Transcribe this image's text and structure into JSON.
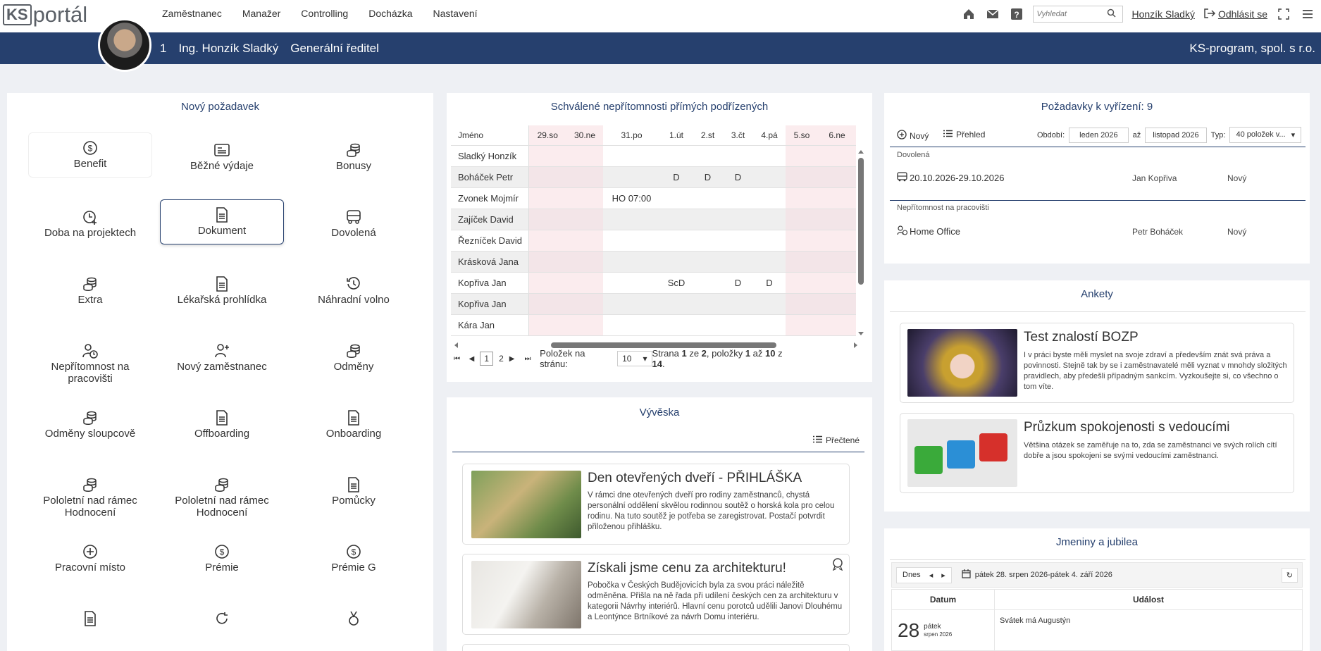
{
  "app": {
    "logo_ks": "KS",
    "logo_text": "portál"
  },
  "nav": {
    "items": [
      "Zaměstnanec",
      "Manažer",
      "Controlling",
      "Docházka",
      "Nastavení"
    ]
  },
  "topright": {
    "search_placeholder": "Vyhledat",
    "user": "Honzík Sladký",
    "logout": "Odhlásit se"
  },
  "userbar": {
    "id": "1",
    "name": "Ing. Honzík Sladký",
    "role": "Generální ředitel",
    "company": "KS-program, spol. s r.o."
  },
  "new_request": {
    "title": "Nový požadavek",
    "items": [
      {
        "label": "Benefit",
        "icon": "dollar-circle-icon"
      },
      {
        "label": "Běžné výdaje",
        "icon": "receipt-icon"
      },
      {
        "label": "Bonusy",
        "icon": "coins-icon"
      },
      {
        "label": "Doba na projektech",
        "icon": "clock-plus-icon"
      },
      {
        "label": "Dokument",
        "icon": "document-icon"
      },
      {
        "label": "Dovolená",
        "icon": "bus-icon"
      },
      {
        "label": "Extra",
        "icon": "coins-icon"
      },
      {
        "label": "Lékařská prohlídka",
        "icon": "document-icon"
      },
      {
        "label": "Náhradní volno",
        "icon": "history-icon"
      },
      {
        "label": "Nepřítomnost na pracovišti",
        "icon": "user-clock-icon"
      },
      {
        "label": "Nový zaměstnanec",
        "icon": "user-plus-icon"
      },
      {
        "label": "Odměny",
        "icon": "coins-icon"
      },
      {
        "label": "Odměny sloupcově",
        "icon": "coins-icon"
      },
      {
        "label": "Offboarding",
        "icon": "document-icon"
      },
      {
        "label": "Onboarding",
        "icon": "document-icon"
      },
      {
        "label": "Pololetní nad rámec Hodnocení",
        "icon": "coins-icon"
      },
      {
        "label": "Pololetní nad rámec Hodnocení",
        "icon": "coins-icon"
      },
      {
        "label": "Pomůcky",
        "icon": "document-icon"
      },
      {
        "label": "Pracovní místo",
        "icon": "plus-circle-icon"
      },
      {
        "label": "Prémie",
        "icon": "dollar-circle-icon"
      },
      {
        "label": "Prémie G",
        "icon": "dollar-circle-icon"
      },
      {
        "label": "",
        "icon": "document-icon"
      },
      {
        "label": "",
        "icon": "refresh-icon"
      },
      {
        "label": "",
        "icon": "medal-icon"
      }
    ]
  },
  "absences": {
    "title": "Schválené nepřítomnosti přímých podřízených",
    "name_header": "Jméno",
    "days": [
      "29.so",
      "30.ne",
      "31.po",
      "1.út",
      "2.st",
      "3.čt",
      "4.pá",
      "5.so",
      "6.ne"
    ],
    "rows": [
      {
        "name": "Sladký Honzík",
        "cells": [
          "",
          "",
          "",
          "",
          "",
          "",
          "",
          "",
          ""
        ]
      },
      {
        "name": "Boháček Petr",
        "cells": [
          "",
          "",
          "",
          "D",
          "D",
          "D",
          "",
          "",
          ""
        ]
      },
      {
        "name": "Zvonek Mojmír",
        "cells": [
          "",
          "",
          "HO 07:00",
          "",
          "",
          "",
          "",
          "",
          ""
        ]
      },
      {
        "name": "Zajíček David",
        "cells": [
          "",
          "",
          "",
          "",
          "",
          "",
          "",
          "",
          ""
        ]
      },
      {
        "name": "Řezníček David",
        "cells": [
          "",
          "",
          "",
          "",
          "",
          "",
          "",
          "",
          ""
        ]
      },
      {
        "name": "Krásková Jana",
        "cells": [
          "",
          "",
          "",
          "",
          "",
          "",
          "",
          "",
          ""
        ]
      },
      {
        "name": "Kopřiva Jan",
        "cells": [
          "",
          "",
          "",
          "ScD",
          "",
          "D",
          "D",
          "",
          ""
        ]
      },
      {
        "name": "Kopřiva Jan",
        "cells": [
          "",
          "",
          "",
          "",
          "",
          "",
          "",
          "",
          ""
        ]
      },
      {
        "name": "Kára Jan",
        "cells": [
          "",
          "",
          "",
          "",
          "",
          "",
          "",
          "",
          ""
        ]
      }
    ],
    "pager": {
      "page1": "1",
      "page2": "2",
      "per_page_label": "Položek na stránu:",
      "per_page": "10",
      "s1": "Strana ",
      "b1": "1",
      "s2": " ze ",
      "b2": "2",
      "s3": ", položky ",
      "b3": "1",
      "s4": " až ",
      "b4": "10",
      "s5": " z ",
      "b5": "14",
      "s6": "."
    }
  },
  "pending": {
    "title": "Požadavky k vyřízení: 9",
    "new_btn": "Nový",
    "overview_btn": "Přehled",
    "period_label": "Období:",
    "from": "leden 2026",
    "to_label": "až",
    "to": "listopad 2026",
    "type_label": "Typ:",
    "type_value": "40 položek v...",
    "groups": [
      {
        "name": "Dovolená",
        "date": "20.10.2026-29.10.2026",
        "person": "Jan Kopřiva",
        "status": "Nový"
      },
      {
        "name": "Nepřítomnost na pracovišti",
        "date": "Home Office",
        "person": "Petr Boháček",
        "status": "Nový"
      }
    ]
  },
  "board": {
    "title": "Vývěska",
    "read_btn": "Přečtené",
    "posts": [
      {
        "title": "Den otevřených dveří - PŘIHLÁŠKA",
        "text": "V rámci dne otevřených dveří pro rodiny zaměstnanců, chystá personální oddělení skvělou rodinnou soutěž o horská kola pro celou rodinu. Na tuto soutěž je potřeba se zaregistrovat. Postačí potvrdit přiloženou přihlášku."
      },
      {
        "title": "Získali jsme cenu za architekturu!",
        "text": "Pobočka v Českých Budějovicích byla za svou práci náležitě odměněna. Přišla na ně řada při udílení českých cen za architekturu v kategorii Návrhy interiérů. Hlavní cenu porotců udělili Janovi Dlouhému a Leontýnce Brtníkové za návrh Domu interiéru."
      }
    ]
  },
  "surveys": {
    "title": "Ankety",
    "items": [
      {
        "title": "Test znalostí BOZP",
        "text": "I v práci byste měli myslet na svoje zdraví a především znát svá práva a povinnosti. Stejně tak by se i zaměstnavatelé měli vyznat v mnohdy složitých pravidlech, aby předešli případným sankcím. Vyzkoušejte si, co všechno o tom víte."
      },
      {
        "title": "Průzkum spokojenosti s vedoucími",
        "text": "Většina otázek se zaměřuje na to, zda se zaměstnanci ve svých rolích cítí dobře a jsou spokojeni se svými vedoucími zaměstnanci."
      }
    ]
  },
  "namedays": {
    "title": "Jmeniny a jubilea",
    "today_btn": "Dnes",
    "range": "pátek 28. srpen 2026-pátek 4. září 2026",
    "col_date": "Datum",
    "col_event": "Událost",
    "rows": [
      {
        "day": "28",
        "weekday": "pátek",
        "month": "srpen 2026",
        "event": "Svátek má Augustýn"
      }
    ]
  }
}
